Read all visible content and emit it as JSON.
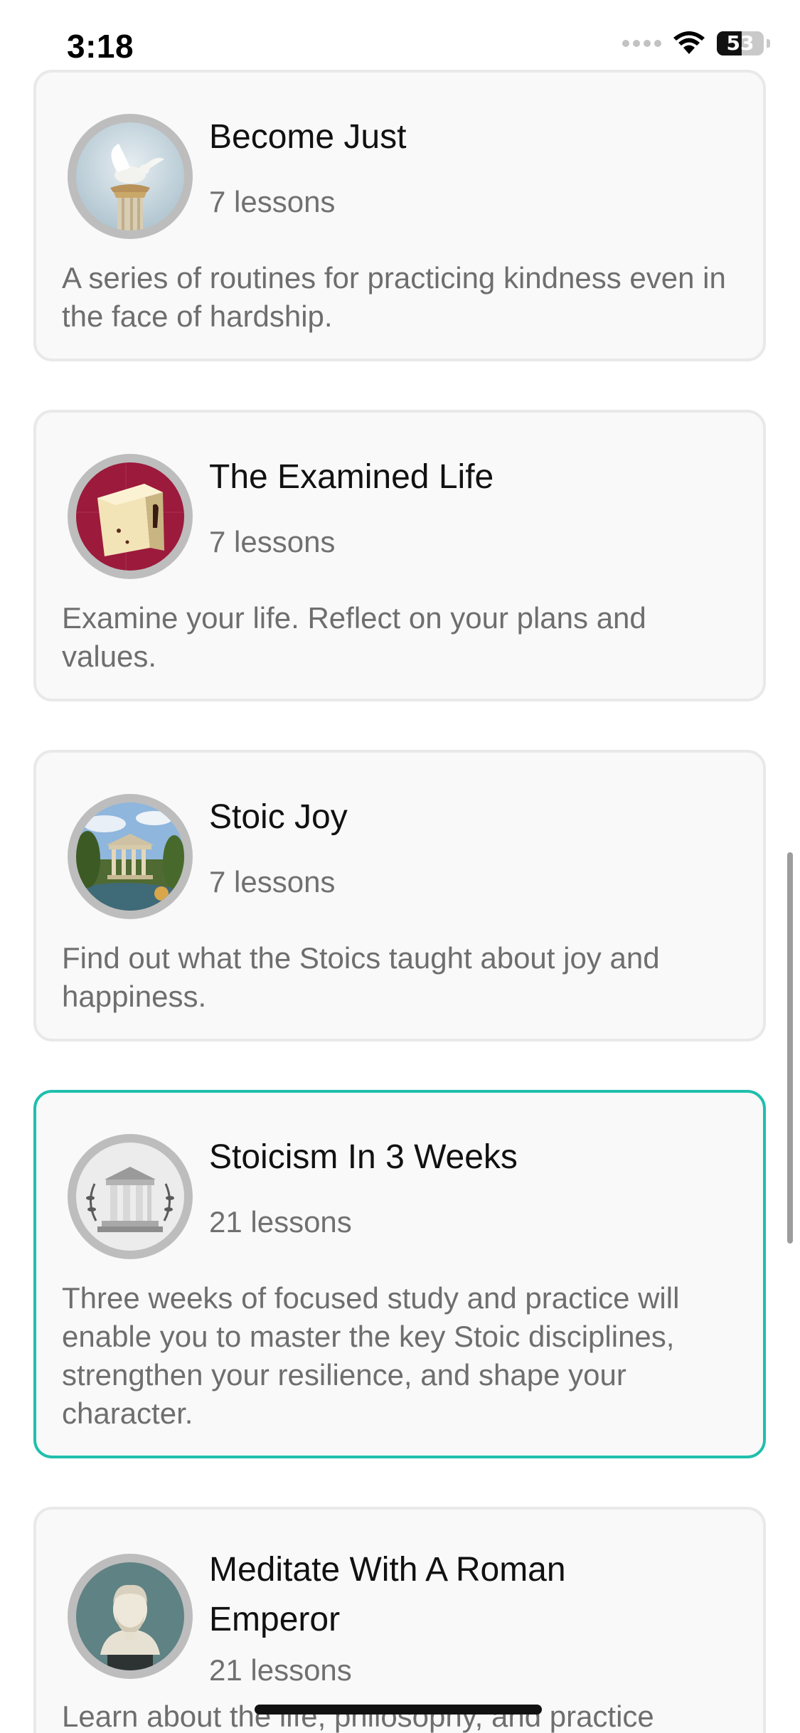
{
  "status_bar": {
    "time": "3:18",
    "battery_level": "53",
    "battery_fraction": 0.53,
    "icons": [
      "cellular-signal-icon",
      "wifi-icon",
      "battery-icon"
    ]
  },
  "courses": [
    {
      "title": "Become Just",
      "lessons": "7 lessons",
      "description": "A series of routines for practicing kindness even in the face of hardship.",
      "image": "dove-on-column-image",
      "selected": false
    },
    {
      "title": "The Examined Life",
      "lessons": "7 lessons",
      "description": "Examine your life. Reflect on your plans and values.",
      "image": "open-box-image",
      "selected": false
    },
    {
      "title": "Stoic Joy",
      "lessons": "7 lessons",
      "description": "Find out what the Stoics taught about joy and happiness.",
      "image": "temple-garden-image",
      "selected": false
    },
    {
      "title": "Stoicism In 3 Weeks",
      "lessons": "21 lessons",
      "description": "Three weeks of focused study and practice will enable you to master the key Stoic disciplines, strengthen your resilience, and shape your character.",
      "image": "greek-temple-laurel-image",
      "selected": true
    },
    {
      "title": "Meditate With A Roman Emperor",
      "lessons": "21 lessons",
      "description": "Learn about the life, philosophy, and practice",
      "image": "marcus-aurelius-bust-image",
      "selected": false
    }
  ],
  "colors": {
    "selected_border": "#1fbfad",
    "card_border": "#e9e9e9",
    "card_background": "#f9f9f9",
    "secondary_text": "#6e6e6e"
  }
}
